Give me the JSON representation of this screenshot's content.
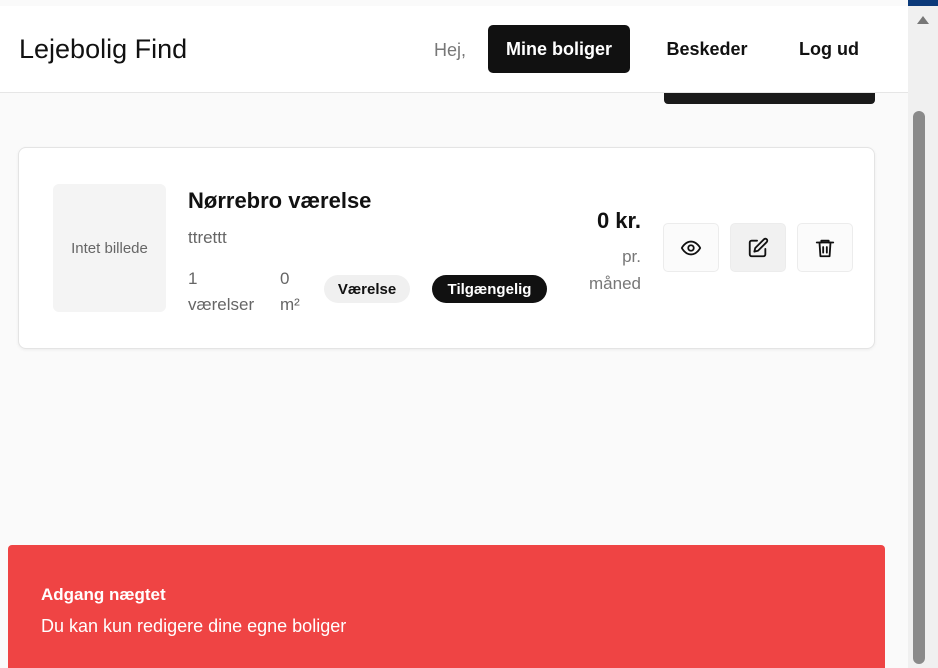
{
  "header": {
    "brand": "Lejebolig Find",
    "greeting": "Hej,",
    "nav": {
      "mine": "Mine boliger",
      "messages": "Beskeder",
      "logout": "Log ud"
    }
  },
  "listing": {
    "thumbnail_placeholder": "Intet billede",
    "title": "Nørrebro værelse",
    "description": "ttrettt",
    "rooms_value": "1",
    "rooms_unit": "værelser",
    "area_value": "0",
    "area_unit": "m²",
    "type_badge": "Værelse",
    "status_badge": "Tilgængelig",
    "price": "0 kr.",
    "price_per_1": "pr.",
    "price_per_2": "måned",
    "actions": [
      "eye-icon",
      "edit-icon",
      "trash-icon"
    ]
  },
  "alert": {
    "title": "Adgang nægtet",
    "message": "Du kan kun redigere dine egne boliger",
    "color": "#ef4444"
  },
  "colors": {
    "topbar": "#0b3a7a",
    "primary": "#111111",
    "background": "#fafafa"
  }
}
